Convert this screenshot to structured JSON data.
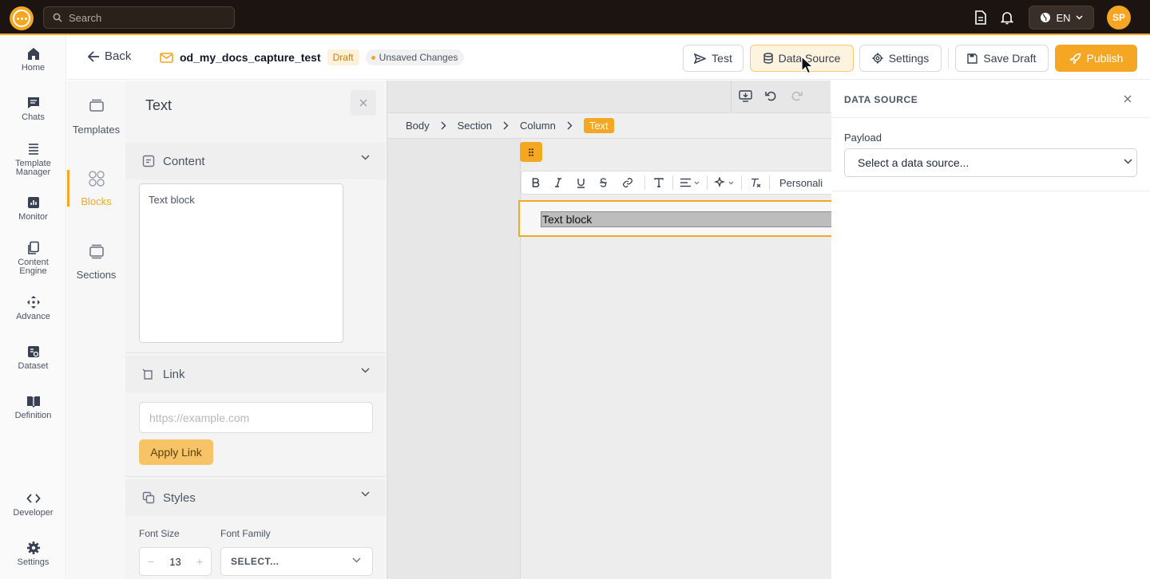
{
  "topbar": {
    "search_placeholder": "Search",
    "language": "EN",
    "user_initials": "SP"
  },
  "rail": {
    "items": [
      {
        "label": "Home",
        "icon": "home-icon"
      },
      {
        "label": "Chats",
        "icon": "chat-icon"
      },
      {
        "label": "Template Manager",
        "icon": "template-manager-icon"
      },
      {
        "label": "Monitor",
        "icon": "monitor-icon"
      },
      {
        "label": "Content Engine",
        "icon": "content-engine-icon"
      },
      {
        "label": "Advance",
        "icon": "advance-icon"
      },
      {
        "label": "Dataset",
        "icon": "dataset-icon"
      },
      {
        "label": "Definition",
        "icon": "definition-icon"
      },
      {
        "label": "Developer",
        "icon": "code-icon"
      },
      {
        "label": "Settings",
        "icon": "gear-icon"
      }
    ]
  },
  "header": {
    "back_label": "Back",
    "doc_name": "od_my_docs_capture_test",
    "status_badge": "Draft",
    "unsaved_label": "Unsaved Changes",
    "test_label": "Test",
    "data_source_label": "Data Source",
    "settings_label": "Settings",
    "save_draft_label": "Save Draft",
    "publish_label": "Publish"
  },
  "blocks_nav": {
    "items": [
      {
        "label": "Templates"
      },
      {
        "label": "Blocks",
        "active": true
      },
      {
        "label": "Sections"
      }
    ]
  },
  "props": {
    "title": "Text",
    "content_section": "Content",
    "content_value": "Text block",
    "link_section": "Link",
    "link_placeholder": "https://example.com",
    "apply_link_label": "Apply Link",
    "styles_section": "Styles",
    "font_size_label": "Font Size",
    "font_size_value": "13",
    "font_family_label": "Font Family",
    "font_family_value": "SELECT...",
    "stepper_minus": "−",
    "stepper_plus": "+"
  },
  "canvas": {
    "breadcrumb": [
      "Body",
      "Section",
      "Column",
      "Text"
    ],
    "personalize_label": "Personali",
    "text_block": "Text block"
  },
  "data_source_panel": {
    "title": "DATA SOURCE",
    "payload_label": "Payload",
    "select_placeholder": "Select a data source..."
  },
  "colors": {
    "accent": "#f5a623",
    "topbar_bg": "#1c1410"
  }
}
